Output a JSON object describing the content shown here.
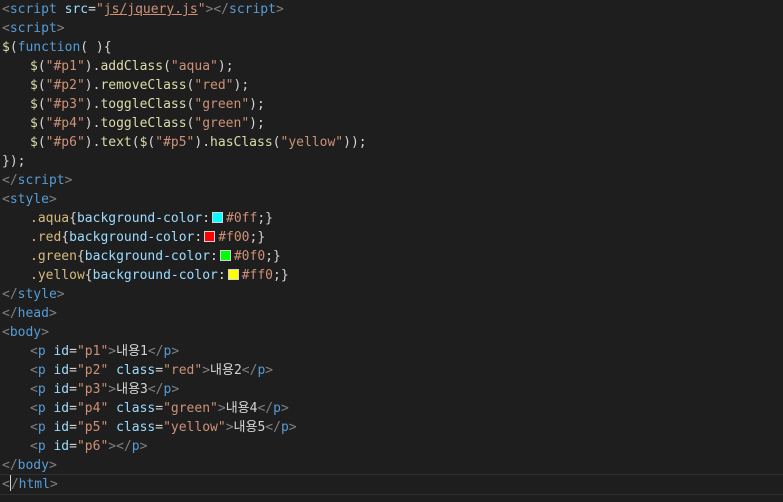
{
  "editor": {
    "lines": [
      [
        {
          "c": "bracket",
          "t": "<"
        },
        {
          "c": "tag",
          "t": "script"
        },
        {
          "c": "plain",
          "t": " "
        },
        {
          "c": "attr",
          "t": "src"
        },
        {
          "c": "plain",
          "t": "="
        },
        {
          "c": "str",
          "t": "\""
        },
        {
          "c": "link",
          "t": "js/jquery.js"
        },
        {
          "c": "str",
          "t": "\""
        },
        {
          "c": "bracket",
          "t": "></"
        },
        {
          "c": "tag",
          "t": "script"
        },
        {
          "c": "bracket",
          "t": ">"
        }
      ],
      [
        {
          "c": "bracket",
          "t": "<"
        },
        {
          "c": "tag",
          "t": "script"
        },
        {
          "c": "bracket",
          "t": ">"
        }
      ],
      [
        {
          "c": "fn",
          "t": "$"
        },
        {
          "c": "plain",
          "t": "("
        },
        {
          "c": "kw",
          "t": "function"
        },
        {
          "c": "plain",
          "t": "( ){"
        }
      ],
      [
        {
          "c": "indent"
        },
        {
          "c": "fn",
          "t": "$"
        },
        {
          "c": "plain",
          "t": "("
        },
        {
          "c": "str",
          "t": "\"#p1\""
        },
        {
          "c": "plain",
          "t": ")."
        },
        {
          "c": "fn",
          "t": "addClass"
        },
        {
          "c": "plain",
          "t": "("
        },
        {
          "c": "str",
          "t": "\"aqua\""
        },
        {
          "c": "plain",
          "t": ");"
        }
      ],
      [
        {
          "c": "indent"
        },
        {
          "c": "fn",
          "t": "$"
        },
        {
          "c": "plain",
          "t": "("
        },
        {
          "c": "str",
          "t": "\"#p2\""
        },
        {
          "c": "plain",
          "t": ")."
        },
        {
          "c": "fn",
          "t": "removeClass"
        },
        {
          "c": "plain",
          "t": "("
        },
        {
          "c": "str",
          "t": "\"red\""
        },
        {
          "c": "plain",
          "t": ");"
        }
      ],
      [
        {
          "c": "indent"
        },
        {
          "c": "fn",
          "t": "$"
        },
        {
          "c": "plain",
          "t": "("
        },
        {
          "c": "str",
          "t": "\"#p3\""
        },
        {
          "c": "plain",
          "t": ")."
        },
        {
          "c": "fn",
          "t": "toggleClass"
        },
        {
          "c": "plain",
          "t": "("
        },
        {
          "c": "str",
          "t": "\"green\""
        },
        {
          "c": "plain",
          "t": ");"
        }
      ],
      [
        {
          "c": "indent"
        },
        {
          "c": "fn",
          "t": "$"
        },
        {
          "c": "plain",
          "t": "("
        },
        {
          "c": "str",
          "t": "\"#p4\""
        },
        {
          "c": "plain",
          "t": ")."
        },
        {
          "c": "fn",
          "t": "toggleClass"
        },
        {
          "c": "plain",
          "t": "("
        },
        {
          "c": "str",
          "t": "\"green\""
        },
        {
          "c": "plain",
          "t": ");"
        }
      ],
      [
        {
          "c": "indent"
        },
        {
          "c": "fn",
          "t": "$"
        },
        {
          "c": "plain",
          "t": "("
        },
        {
          "c": "str",
          "t": "\"#p6\""
        },
        {
          "c": "plain",
          "t": ")."
        },
        {
          "c": "fn",
          "t": "text"
        },
        {
          "c": "plain",
          "t": "("
        },
        {
          "c": "fn",
          "t": "$"
        },
        {
          "c": "plain",
          "t": "("
        },
        {
          "c": "str",
          "t": "\"#p5\""
        },
        {
          "c": "plain",
          "t": ")."
        },
        {
          "c": "fn",
          "t": "hasClass"
        },
        {
          "c": "plain",
          "t": "("
        },
        {
          "c": "str",
          "t": "\"yellow\""
        },
        {
          "c": "plain",
          "t": "));"
        }
      ],
      [
        {
          "c": "plain",
          "t": "});"
        }
      ],
      [
        {
          "c": "bracket",
          "t": "</"
        },
        {
          "c": "tag",
          "t": "script"
        },
        {
          "c": "bracket",
          "t": ">"
        }
      ],
      [
        {
          "c": "bracket",
          "t": "<"
        },
        {
          "c": "tag",
          "t": "style"
        },
        {
          "c": "bracket",
          "t": ">"
        }
      ],
      [
        {
          "c": "indent"
        },
        {
          "c": "sel",
          "t": ".aqua"
        },
        {
          "c": "plain",
          "t": "{"
        },
        {
          "c": "prop",
          "t": "background-color"
        },
        {
          "c": "plain",
          "t": ":"
        },
        {
          "c": "swatch",
          "color": "#00ffff"
        },
        {
          "c": "val",
          "t": "#0ff"
        },
        {
          "c": "plain",
          "t": ";}"
        }
      ],
      [
        {
          "c": "indent"
        },
        {
          "c": "sel",
          "t": ".red"
        },
        {
          "c": "plain",
          "t": "{"
        },
        {
          "c": "prop",
          "t": "background-color"
        },
        {
          "c": "plain",
          "t": ":"
        },
        {
          "c": "swatch",
          "color": "#ff0000"
        },
        {
          "c": "val",
          "t": "#f00"
        },
        {
          "c": "plain",
          "t": ";}"
        }
      ],
      [
        {
          "c": "indent"
        },
        {
          "c": "sel",
          "t": ".green"
        },
        {
          "c": "plain",
          "t": "{"
        },
        {
          "c": "prop",
          "t": "background-color"
        },
        {
          "c": "plain",
          "t": ":"
        },
        {
          "c": "swatch",
          "color": "#00ff00"
        },
        {
          "c": "val",
          "t": "#0f0"
        },
        {
          "c": "plain",
          "t": ";}"
        }
      ],
      [
        {
          "c": "indent"
        },
        {
          "c": "sel",
          "t": ".yellow"
        },
        {
          "c": "plain",
          "t": "{"
        },
        {
          "c": "prop",
          "t": "background-color"
        },
        {
          "c": "plain",
          "t": ":"
        },
        {
          "c": "swatch",
          "color": "#ffff00"
        },
        {
          "c": "val",
          "t": "#ff0"
        },
        {
          "c": "plain",
          "t": ";}"
        }
      ],
      [
        {
          "c": "bracket",
          "t": "</"
        },
        {
          "c": "tag",
          "t": "style"
        },
        {
          "c": "bracket",
          "t": ">"
        }
      ],
      [
        {
          "c": "bracket",
          "t": "</"
        },
        {
          "c": "tag",
          "t": "head"
        },
        {
          "c": "bracket",
          "t": ">"
        }
      ],
      [
        {
          "c": "bracket",
          "t": "<"
        },
        {
          "c": "tag",
          "t": "body"
        },
        {
          "c": "bracket",
          "t": ">"
        }
      ],
      [
        {
          "c": "indent"
        },
        {
          "c": "bracket",
          "t": "<"
        },
        {
          "c": "tag",
          "t": "p"
        },
        {
          "c": "plain",
          "t": " "
        },
        {
          "c": "attr",
          "t": "id"
        },
        {
          "c": "plain",
          "t": "="
        },
        {
          "c": "str",
          "t": "\"p1\""
        },
        {
          "c": "bracket",
          "t": ">"
        },
        {
          "c": "plain",
          "t": "내용1"
        },
        {
          "c": "bracket",
          "t": "</"
        },
        {
          "c": "tag",
          "t": "p"
        },
        {
          "c": "bracket",
          "t": ">"
        }
      ],
      [
        {
          "c": "indent"
        },
        {
          "c": "bracket",
          "t": "<"
        },
        {
          "c": "tag",
          "t": "p"
        },
        {
          "c": "plain",
          "t": " "
        },
        {
          "c": "attr",
          "t": "id"
        },
        {
          "c": "plain",
          "t": "="
        },
        {
          "c": "str",
          "t": "\"p2\""
        },
        {
          "c": "plain",
          "t": " "
        },
        {
          "c": "attr",
          "t": "class"
        },
        {
          "c": "plain",
          "t": "="
        },
        {
          "c": "str",
          "t": "\"red\""
        },
        {
          "c": "bracket",
          "t": ">"
        },
        {
          "c": "plain",
          "t": "내용2"
        },
        {
          "c": "bracket",
          "t": "</"
        },
        {
          "c": "tag",
          "t": "p"
        },
        {
          "c": "bracket",
          "t": ">"
        }
      ],
      [
        {
          "c": "indent"
        },
        {
          "c": "bracket",
          "t": "<"
        },
        {
          "c": "tag",
          "t": "p"
        },
        {
          "c": "plain",
          "t": " "
        },
        {
          "c": "attr",
          "t": "id"
        },
        {
          "c": "plain",
          "t": "="
        },
        {
          "c": "str",
          "t": "\"p3\""
        },
        {
          "c": "bracket",
          "t": ">"
        },
        {
          "c": "plain",
          "t": "내용3"
        },
        {
          "c": "bracket",
          "t": "</"
        },
        {
          "c": "tag",
          "t": "p"
        },
        {
          "c": "bracket",
          "t": ">"
        }
      ],
      [
        {
          "c": "indent"
        },
        {
          "c": "bracket",
          "t": "<"
        },
        {
          "c": "tag",
          "t": "p"
        },
        {
          "c": "plain",
          "t": " "
        },
        {
          "c": "attr",
          "t": "id"
        },
        {
          "c": "plain",
          "t": "="
        },
        {
          "c": "str",
          "t": "\"p4\""
        },
        {
          "c": "plain",
          "t": " "
        },
        {
          "c": "attr",
          "t": "class"
        },
        {
          "c": "plain",
          "t": "="
        },
        {
          "c": "str",
          "t": "\"green\""
        },
        {
          "c": "bracket",
          "t": ">"
        },
        {
          "c": "plain",
          "t": "내용4"
        },
        {
          "c": "bracket",
          "t": "</"
        },
        {
          "c": "tag",
          "t": "p"
        },
        {
          "c": "bracket",
          "t": ">"
        }
      ],
      [
        {
          "c": "indent"
        },
        {
          "c": "bracket",
          "t": "<"
        },
        {
          "c": "tag",
          "t": "p"
        },
        {
          "c": "plain",
          "t": " "
        },
        {
          "c": "attr",
          "t": "id"
        },
        {
          "c": "plain",
          "t": "="
        },
        {
          "c": "str",
          "t": "\"p5\""
        },
        {
          "c": "plain",
          "t": " "
        },
        {
          "c": "attr",
          "t": "class"
        },
        {
          "c": "plain",
          "t": "="
        },
        {
          "c": "str",
          "t": "\"yellow\""
        },
        {
          "c": "bracket",
          "t": ">"
        },
        {
          "c": "plain",
          "t": "내용5"
        },
        {
          "c": "bracket",
          "t": "</"
        },
        {
          "c": "tag",
          "t": "p"
        },
        {
          "c": "bracket",
          "t": ">"
        }
      ],
      [
        {
          "c": "indent"
        },
        {
          "c": "bracket",
          "t": "<"
        },
        {
          "c": "tag",
          "t": "p"
        },
        {
          "c": "plain",
          "t": " "
        },
        {
          "c": "attr",
          "t": "id"
        },
        {
          "c": "plain",
          "t": "="
        },
        {
          "c": "str",
          "t": "\"p6\""
        },
        {
          "c": "bracket",
          "t": "></"
        },
        {
          "c": "tag",
          "t": "p"
        },
        {
          "c": "bracket",
          "t": ">"
        }
      ],
      [
        {
          "c": "bracket",
          "t": "</"
        },
        {
          "c": "tag",
          "t": "body"
        },
        {
          "c": "bracket",
          "t": ">"
        }
      ],
      [
        {
          "c": "bracket",
          "t": "<"
        },
        {
          "c": "cursor"
        },
        {
          "c": "bracket",
          "t": "/"
        },
        {
          "c": "tag",
          "t": "html"
        },
        {
          "c": "bracket",
          "t": ">"
        }
      ]
    ],
    "current_line": 25
  }
}
